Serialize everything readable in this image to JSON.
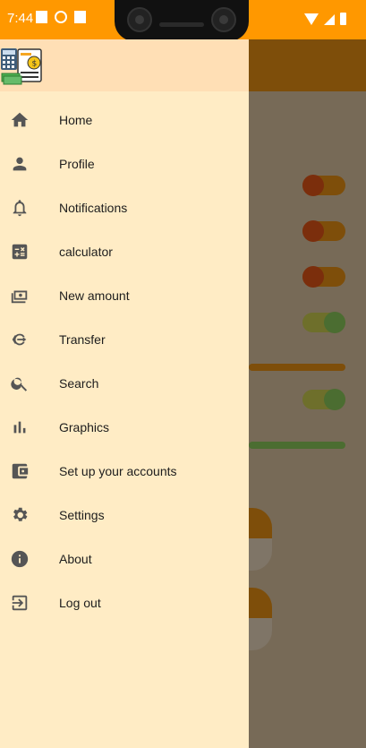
{
  "status_bar": {
    "time": "7:44",
    "icons": [
      "notification-icon",
      "settings-icon",
      "sd-card-icon"
    ],
    "right_icons": [
      "wifi-icon",
      "signal-icon",
      "battery-icon"
    ],
    "color": "#ff9800"
  },
  "drawer": {
    "background": "#ffecc5",
    "header_background": "#ffdfb5",
    "logo": "finance-app-logo",
    "items": [
      {
        "label": "Home",
        "icon": "home-icon"
      },
      {
        "label": "Profile",
        "icon": "person-icon"
      },
      {
        "label": "Notifications",
        "icon": "bell-icon"
      },
      {
        "label": "calculator",
        "icon": "calculator-icon"
      },
      {
        "label": "New amount",
        "icon": "money-icon"
      },
      {
        "label": "Transfer",
        "icon": "transfer-icon"
      },
      {
        "label": "Search",
        "icon": "search-icon"
      },
      {
        "label": "Graphics",
        "icon": "bar-chart-icon"
      },
      {
        "label": "Set up your accounts",
        "icon": "wallet-icon"
      },
      {
        "label": "Settings",
        "icon": "gear-icon"
      },
      {
        "label": "About",
        "icon": "info-icon"
      },
      {
        "label": "Log out",
        "icon": "logout-icon"
      }
    ]
  },
  "background_app": {
    "toggles": [
      {
        "state": "off"
      },
      {
        "state": "off"
      },
      {
        "state": "off"
      },
      {
        "state": "on"
      },
      {
        "state": "on"
      }
    ]
  }
}
